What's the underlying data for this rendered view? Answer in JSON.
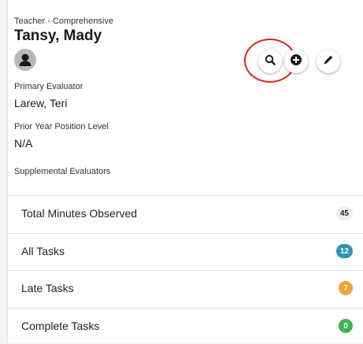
{
  "profile": {
    "role": "Teacher - Comprehensive",
    "name": "Tansy, Mady",
    "avatar_icon": "user-avatar-icon"
  },
  "actions": {
    "search_icon": "search-icon",
    "add_icon": "plus-circle-icon",
    "edit_icon": "pencil-icon",
    "highlight_color": "#e0241a"
  },
  "fields": {
    "primary_evaluator_label": "Primary Evaluator",
    "primary_evaluator_value": "Larew, Teri",
    "prior_year_label": "Prior Year Position Level",
    "prior_year_value": "N/A",
    "supplemental_label": "Supplemental Evaluators"
  },
  "stats": [
    {
      "label": "Total Minutes Observed",
      "count": "45",
      "color": "#eeeeee"
    },
    {
      "label": "All Tasks",
      "count": "12",
      "color": "#2f93b5"
    },
    {
      "label": "Late Tasks",
      "count": "7",
      "color": "#f0a13a"
    },
    {
      "label": "Complete Tasks",
      "count": "0",
      "color": "#3fb34f"
    }
  ]
}
